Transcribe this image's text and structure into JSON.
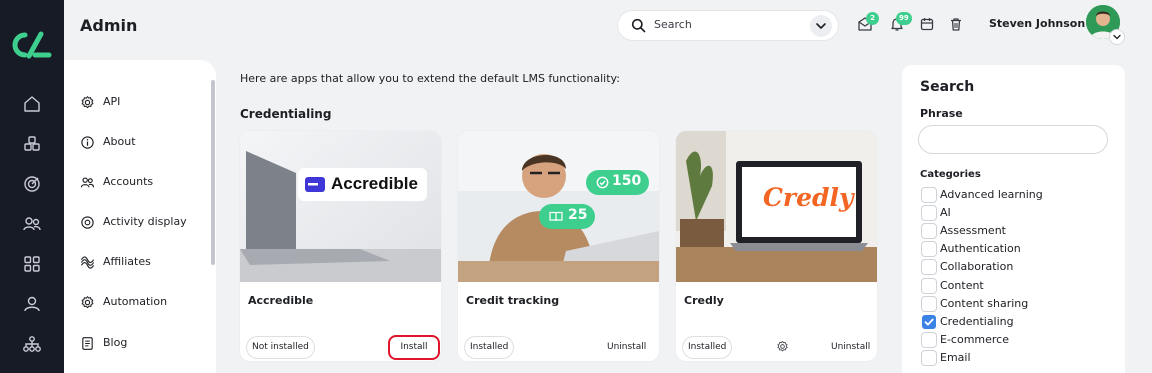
{
  "app": {
    "title": "Admin"
  },
  "rail": {
    "items": [
      "home-icon",
      "courses-icon",
      "target-icon",
      "users-icon",
      "apps-icon",
      "profile-icon",
      "sitemap-icon"
    ]
  },
  "header": {
    "search_placeholder": "Search",
    "messages_badge": "2",
    "notifications_badge": "99",
    "user_name": "Steven Johnson"
  },
  "menu": {
    "items": [
      {
        "label": "API",
        "icon": "gear-icon"
      },
      {
        "label": "About",
        "icon": "info-icon"
      },
      {
        "label": "Accounts",
        "icon": "accounts-icon"
      },
      {
        "label": "Activity display",
        "icon": "activity-icon"
      },
      {
        "label": "Affiliates",
        "icon": "affiliates-icon"
      },
      {
        "label": "Automation",
        "icon": "gear-icon"
      },
      {
        "label": "Blog",
        "icon": "document-icon"
      }
    ]
  },
  "main": {
    "intro": "Here are apps that allow you to extend the default LMS functionality:",
    "section_title": "Credentialing",
    "cards": [
      {
        "title": "Accredible",
        "status": "Not installed",
        "action": "Install",
        "logo_text": "Accredible"
      },
      {
        "title": "Credit tracking",
        "status": "Installed",
        "action": "Uninstall",
        "credits_a": "150",
        "credits_b": "25"
      },
      {
        "title": "Credly",
        "status": "Installed",
        "action": "Uninstall",
        "logo_text": "Credly"
      }
    ]
  },
  "filters": {
    "title": "Search",
    "phrase_label": "Phrase",
    "phrase_value": "",
    "categories_label": "Categories",
    "categories": [
      {
        "label": "Advanced learning",
        "checked": false
      },
      {
        "label": "AI",
        "checked": false
      },
      {
        "label": "Assessment",
        "checked": false
      },
      {
        "label": "Authentication",
        "checked": false
      },
      {
        "label": "Collaboration",
        "checked": false
      },
      {
        "label": "Content",
        "checked": false
      },
      {
        "label": "Content sharing",
        "checked": false
      },
      {
        "label": "Credentialing",
        "checked": true
      },
      {
        "label": "E-commerce",
        "checked": false
      },
      {
        "label": "Email",
        "checked": false
      }
    ]
  },
  "colors": {
    "rail": "#161b26",
    "accent": "#3ecf8e",
    "highlight": "#e0142b",
    "checkbox": "#3b82e6"
  }
}
